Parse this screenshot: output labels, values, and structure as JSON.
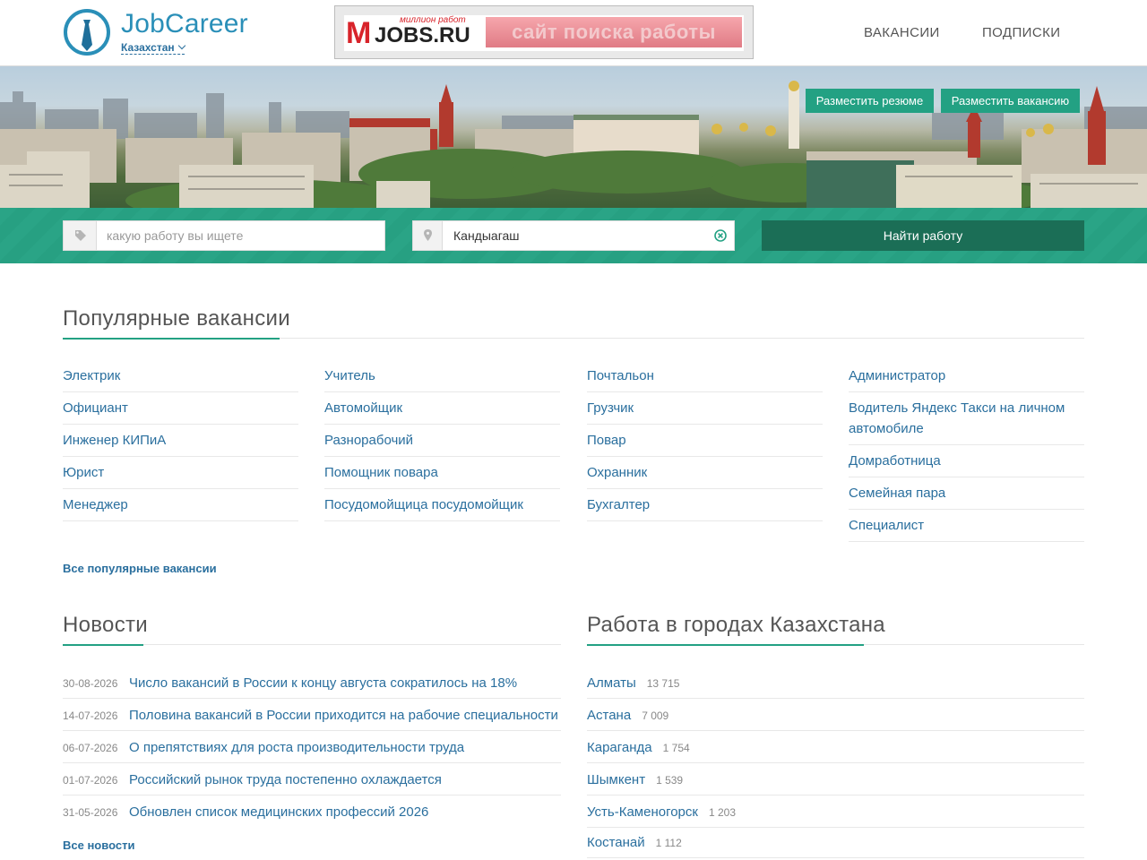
{
  "header": {
    "brand": "JobCareer",
    "region": "Казахстан",
    "banner": {
      "top": "миллион работ",
      "m": "M",
      "jobs": "JOBS.RU",
      "slogan": "сайт поиска работы"
    },
    "nav": [
      "ВАКАНСИИ",
      "ПОДПИСКИ"
    ]
  },
  "hero": {
    "post_resume": "Разместить резюме",
    "post_vacancy": "Разместить вакансию"
  },
  "search": {
    "query_placeholder": "какую работу вы ищете",
    "location_value": "Кандыагаш",
    "find_button": "Найти работу"
  },
  "popular": {
    "title": "Популярные вакансии",
    "columns": [
      [
        "Электрик",
        "Официант",
        "Инженер КИПиА",
        "Юрист",
        "Менеджер"
      ],
      [
        "Учитель",
        "Автомойщик",
        "Разнорабочий",
        "Помощник повара",
        "Посудомойщица посудомойщик"
      ],
      [
        "Почтальон",
        "Грузчик",
        "Повар",
        "Охранник",
        "Бухгалтер"
      ],
      [
        "Администратор",
        "Водитель Яндекс Такси на личном автомобиле",
        "Домработница",
        "Семейная пара",
        "Специалист"
      ]
    ],
    "all_link": "Все популярные вакансии"
  },
  "news": {
    "title": "Новости",
    "items": [
      {
        "date": "30-08-2026",
        "title": "Число вакансий в России к концу августа сократилось на 18%"
      },
      {
        "date": "14-07-2026",
        "title": "Половина вакансий в России приходится на рабочие специальности"
      },
      {
        "date": "06-07-2026",
        "title": "О препятствиях для роста производительности труда"
      },
      {
        "date": "01-07-2026",
        "title": "Российский рынок труда постепенно охлаждается"
      },
      {
        "date": "31-05-2026",
        "title": "Обновлен список медицинских профессий 2026"
      }
    ],
    "all_link": "Все новости"
  },
  "cities": {
    "title": "Работа в городах Казахстана",
    "items": [
      {
        "name": "Алматы",
        "count": "13 715"
      },
      {
        "name": "Астана",
        "count": "7 009"
      },
      {
        "name": "Караганда",
        "count": "1 754"
      },
      {
        "name": "Шымкент",
        "count": "1 539"
      },
      {
        "name": "Усть-Каменогорск",
        "count": "1 203"
      },
      {
        "name": "Костанай",
        "count": "1 112"
      }
    ]
  },
  "colors": {
    "accent": "#23a183",
    "link": "#2a6f9e",
    "brand": "#2a8fb8",
    "button_dark": "#1b6e56"
  }
}
